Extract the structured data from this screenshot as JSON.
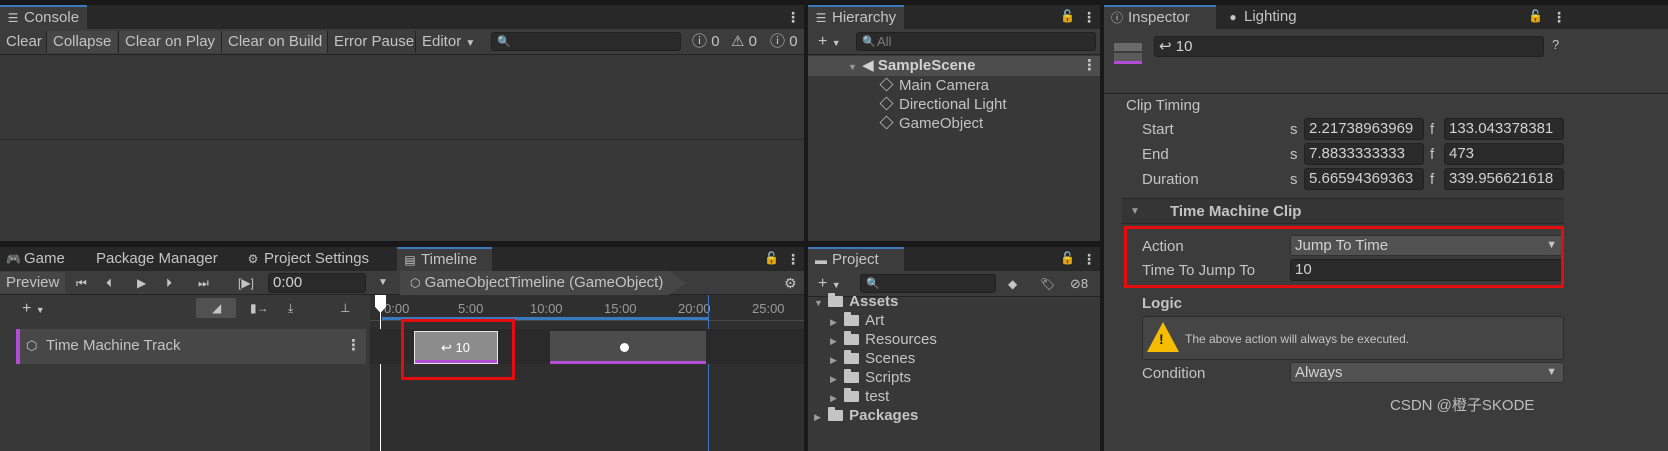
{
  "console": {
    "tab": "Console",
    "buttons": [
      "Clear",
      "Collapse",
      "Clear on Play",
      "Clear on Build",
      "Error Pause",
      "Editor"
    ],
    "counts": [
      "0",
      "0",
      "0"
    ]
  },
  "hierarchy": {
    "tab": "Hierarchy",
    "search_placeholder": "All",
    "scene": "SampleScene",
    "items": [
      "Main Camera",
      "Directional Light",
      "GameObject"
    ]
  },
  "inspector": {
    "tabs": [
      "Inspector",
      "Lighting"
    ],
    "object_name": "↩ 10",
    "clip_timing": {
      "header": "Clip Timing",
      "rows": [
        {
          "label": "Start",
          "s_label": "s",
          "s": "2.21738963969",
          "f_label": "f",
          "f": "133.043378381"
        },
        {
          "label": "End",
          "s_label": "s",
          "s": "7.8833333333",
          "f_label": "f",
          "f": "473"
        },
        {
          "label": "Duration",
          "s_label": "s",
          "s": "5.66594369363",
          "f_label": "f",
          "f": "339.956621618"
        }
      ]
    },
    "clip_header": "Time Machine Clip",
    "action_label": "Action",
    "action_value": "Jump To Time",
    "time_label": "Time To Jump To",
    "time_value": "10",
    "logic_header": "Logic",
    "logic_message": "The above action will always be executed.",
    "condition_label": "Condition",
    "condition_value": "Always",
    "watermark": "CSDN @橙子SKODE"
  },
  "bottom_tabs": [
    "Game",
    "Package Manager",
    "Project Settings",
    "Timeline"
  ],
  "timeline": {
    "preview": "Preview",
    "time": "0:00",
    "asset": "GameObjectTimeline (GameObject)",
    "ruler": [
      "0:00",
      "5:00",
      "10:00",
      "15:00",
      "20:00",
      "25:00"
    ],
    "track_name": "Time Machine Track",
    "clip_label": "↩ 10"
  },
  "project": {
    "tab": "Project",
    "hidden_count": "8",
    "root": "Assets",
    "folders": [
      "Art",
      "Resources",
      "Scenes",
      "Scripts",
      "test"
    ],
    "packages": "Packages"
  }
}
